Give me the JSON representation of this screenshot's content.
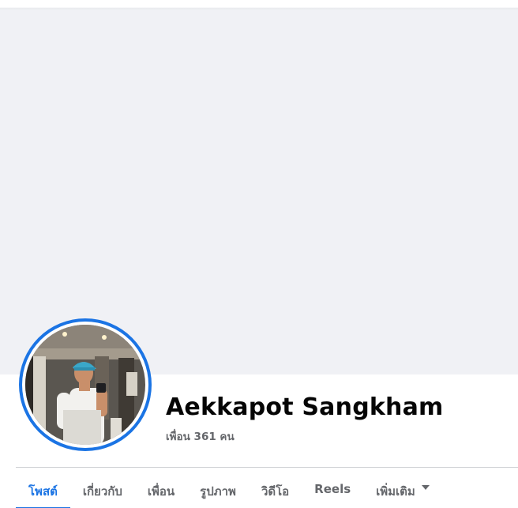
{
  "profile": {
    "name": "Aekkapot Sangkham",
    "friends_count": "เพื่อน 361 คน"
  },
  "tabs": [
    {
      "label": "โพสต์",
      "active": true
    },
    {
      "label": "เกี่ยวกับ",
      "active": false
    },
    {
      "label": "เพื่อน",
      "active": false
    },
    {
      "label": "รูปภาพ",
      "active": false
    },
    {
      "label": "วิดีโอ",
      "active": false
    },
    {
      "label": "Reels",
      "active": false
    },
    {
      "label": "เพิ่มเติม",
      "active": false,
      "icon": "caret-down-icon"
    }
  ],
  "colors": {
    "accent": "#1b74e4",
    "cover": "#f0f1f5",
    "text_primary": "#050505",
    "text_secondary": "#65676b"
  }
}
